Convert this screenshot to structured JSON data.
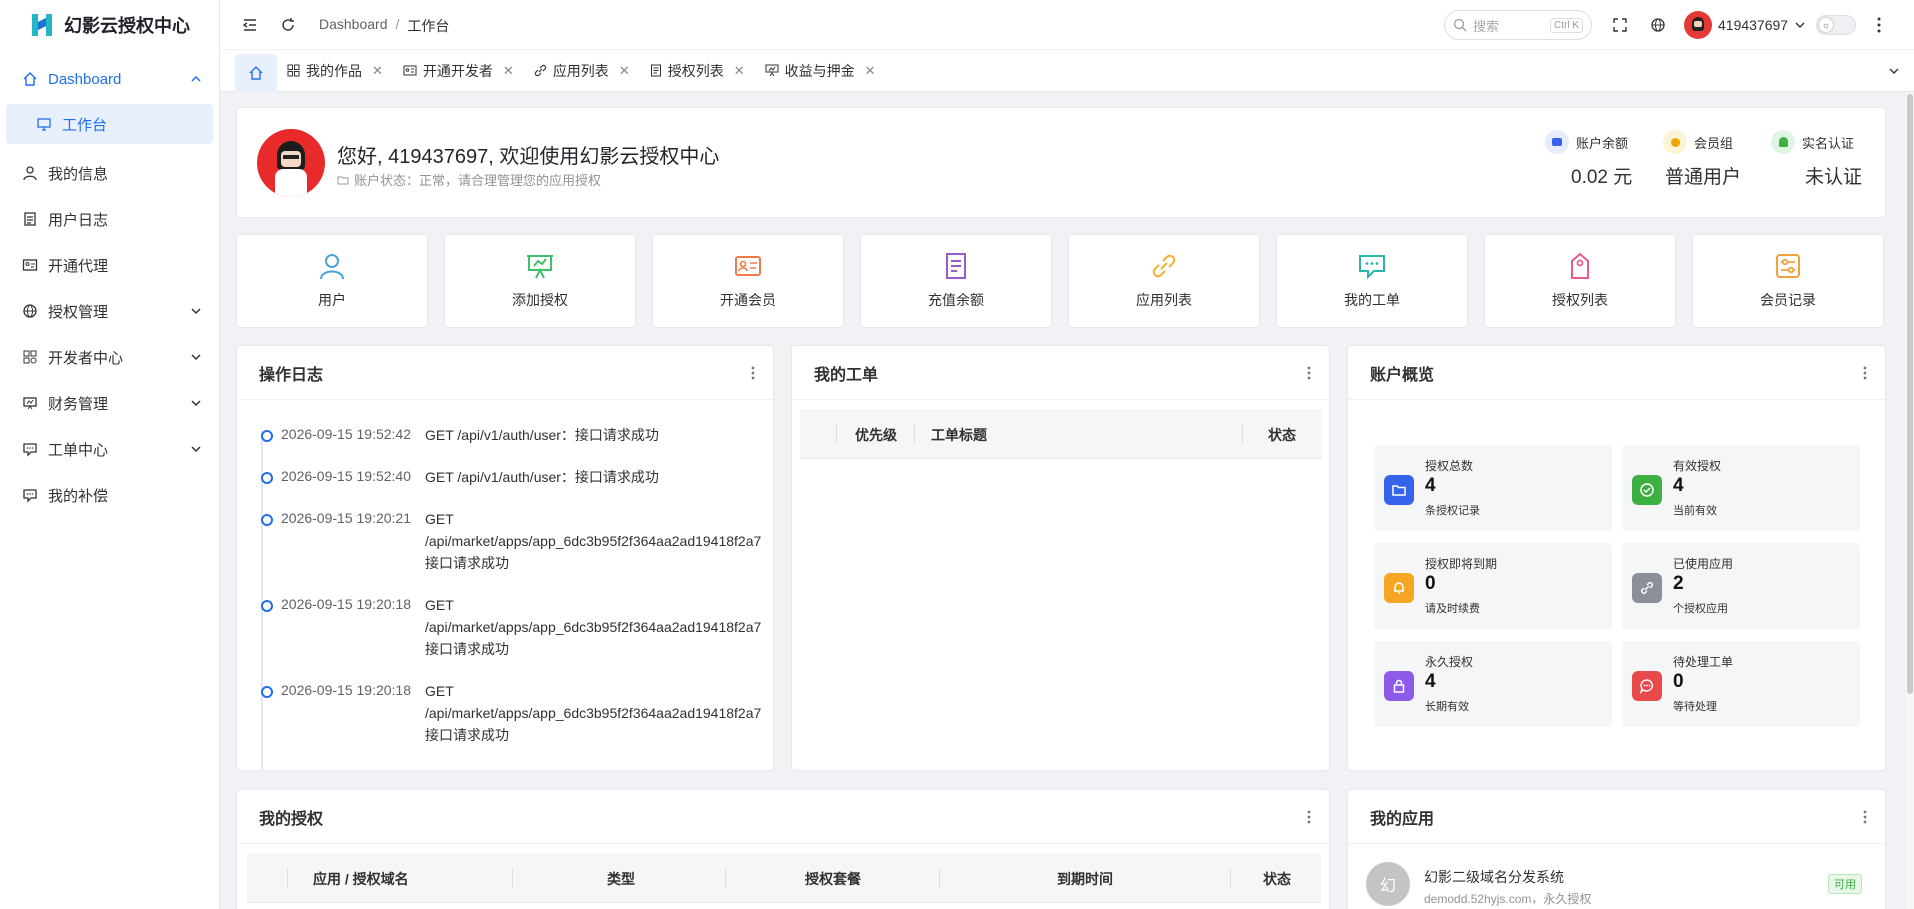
{
  "app": {
    "title": "幻影云授权中心"
  },
  "sidebar": {
    "items": [
      {
        "label": "Dashboard"
      },
      {
        "label": "工作台"
      },
      {
        "label": "我的信息"
      },
      {
        "label": "用户日志"
      },
      {
        "label": "开通代理"
      },
      {
        "label": "授权管理"
      },
      {
        "label": "开发者中心"
      },
      {
        "label": "财务管理"
      },
      {
        "label": "工单中心"
      },
      {
        "label": "我的补偿"
      }
    ]
  },
  "header": {
    "breadcrumb": [
      "Dashboard",
      "/",
      "工作台"
    ],
    "search_placeholder": "搜索",
    "search_shortcut": "Ctrl K",
    "username": "419437697"
  },
  "tabs": [
    {
      "label": "我的作品"
    },
    {
      "label": "开通开发者"
    },
    {
      "label": "应用列表"
    },
    {
      "label": "授权列表"
    },
    {
      "label": "收益与押金"
    }
  ],
  "welcome": {
    "greeting": "您好, 419437697, 欢迎使用幻影云授权中心",
    "status": "账户状态：正常，请合理管理您的应用授权",
    "stats": [
      {
        "label": "账户余额",
        "value": "0.02 元"
      },
      {
        "label": "会员组",
        "value": "普通用户"
      },
      {
        "label": "实名认证",
        "value": "未认证"
      }
    ]
  },
  "quick_actions": [
    {
      "label": "用户",
      "icon": "user-icon",
      "color": "#4aa3df"
    },
    {
      "label": "添加授权",
      "icon": "presentation-icon",
      "color": "#3fbf6a"
    },
    {
      "label": "开通会员",
      "icon": "id-card-icon",
      "color": "#f07b4a"
    },
    {
      "label": "充值余额",
      "icon": "document-icon",
      "color": "#9b59d0"
    },
    {
      "label": "应用列表",
      "icon": "link-icon",
      "color": "#f2b134"
    },
    {
      "label": "我的工单",
      "icon": "chat-icon",
      "color": "#2ab7a9"
    },
    {
      "label": "授权列表",
      "icon": "tag-icon",
      "color": "#e85b8a"
    },
    {
      "label": "会员记录",
      "icon": "settings-icon",
      "color": "#f0a03c"
    }
  ],
  "op_log": {
    "title": "操作日志",
    "entries": [
      {
        "time": "2026-09-15 19:52:42",
        "lines": [
          "GET /api/v1/auth/user：接口请求成功"
        ]
      },
      {
        "time": "2026-09-15 19:52:40",
        "lines": [
          "GET /api/v1/auth/user：接口请求成功"
        ]
      },
      {
        "time": "2026-09-15 19:20:21",
        "lines": [
          "GET",
          "/api/market/apps/app_6dc3b95f2f364aa2ad19418f2a7",
          "接口请求成功"
        ]
      },
      {
        "time": "2026-09-15 19:20:18",
        "lines": [
          "GET",
          "/api/market/apps/app_6dc3b95f2f364aa2ad19418f2a7",
          "接口请求成功"
        ]
      },
      {
        "time": "2026-09-15 19:20:18",
        "lines": [
          "GET",
          "/api/market/apps/app_6dc3b95f2f364aa2ad19418f2a7",
          "接口请求成功"
        ]
      }
    ]
  },
  "tickets": {
    "title": "我的工单",
    "columns": [
      "优先级",
      "工单标题",
      "状态"
    ]
  },
  "overview": {
    "title": "账户概览",
    "stats": [
      {
        "label": "授权总数",
        "value": "4",
        "sub": "条授权记录",
        "color": "#3563e9"
      },
      {
        "label": "有效授权",
        "value": "4",
        "sub": "当前有效",
        "color": "#3cb043"
      },
      {
        "label": "授权即将到期",
        "value": "0",
        "sub": "请及时续费",
        "color": "#f5a623"
      },
      {
        "label": "已使用应用",
        "value": "2",
        "sub": "个授权应用",
        "color": "#8a8f99"
      },
      {
        "label": "永久授权",
        "value": "4",
        "sub": "长期有效",
        "color": "#8e5be8"
      },
      {
        "label": "待处理工单",
        "value": "0",
        "sub": "等待处理",
        "color": "#e84a4a"
      }
    ]
  },
  "my_auth": {
    "title": "我的授权",
    "columns": [
      "应用 / 授权域名",
      "类型",
      "授权套餐",
      "到期时间",
      "状态"
    ]
  },
  "my_apps": {
    "title": "我的应用",
    "items": [
      {
        "avatar": "幻",
        "name": "幻影二级域名分发系统",
        "meta": "demodd.52hyjs.com，永久授权",
        "badge": "可用"
      }
    ]
  }
}
